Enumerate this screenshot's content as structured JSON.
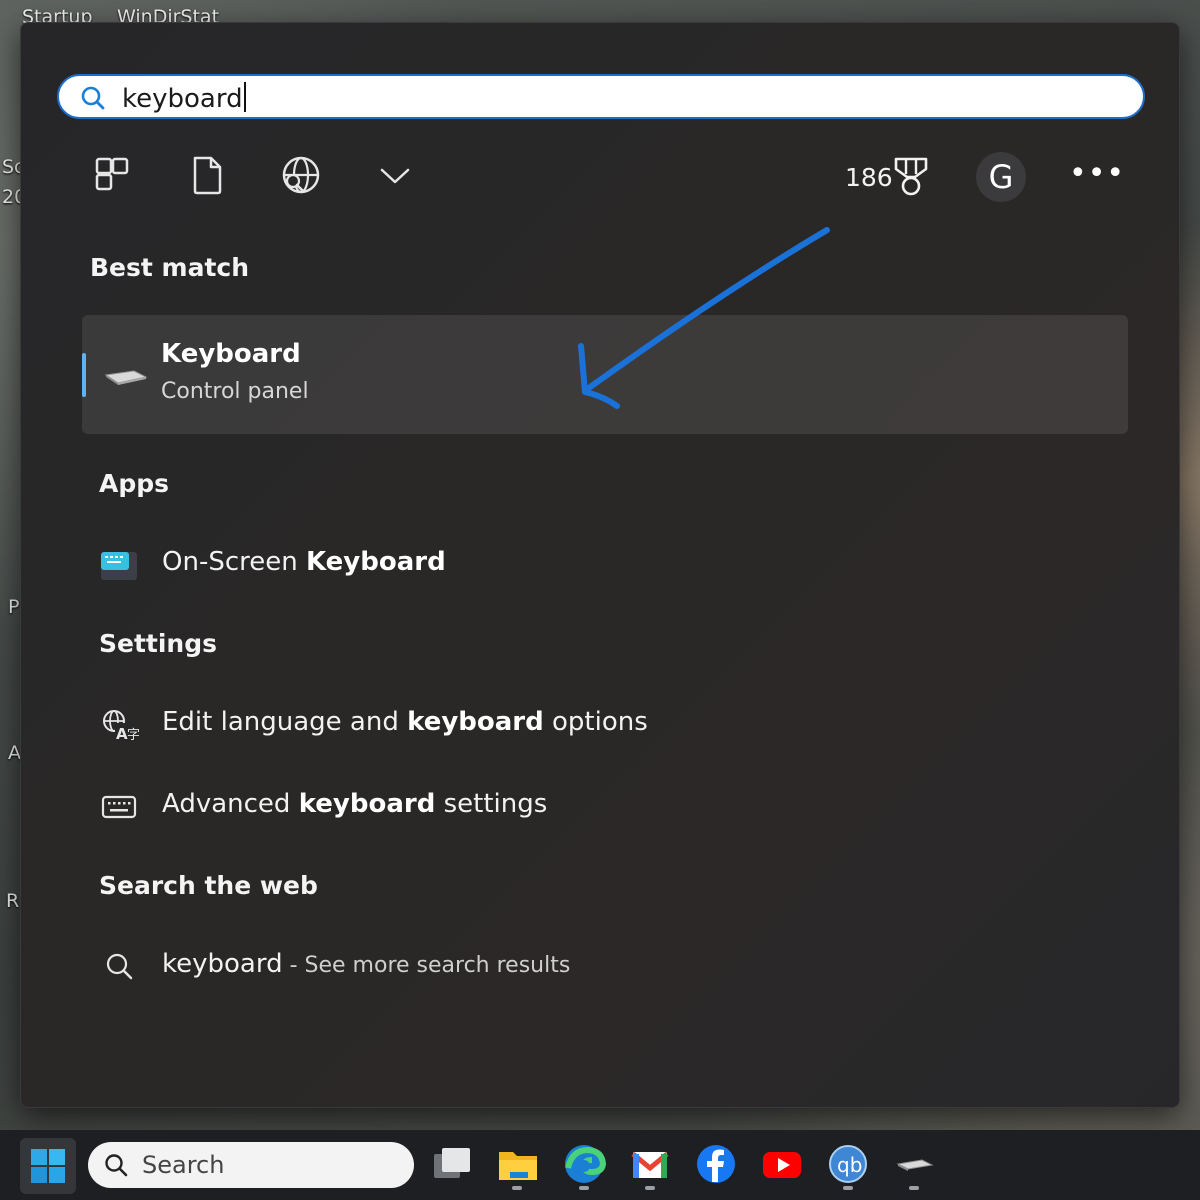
{
  "desktop": {
    "labels": [
      "Startup",
      "WinDirStat",
      "Sc",
      "20",
      "P",
      "A",
      "R"
    ]
  },
  "search": {
    "query": "keyboard"
  },
  "filters": {
    "icons": [
      "apps-filter-icon",
      "documents-filter-icon",
      "web-filter-icon",
      "more-filters-chevron-icon"
    ]
  },
  "header": {
    "points": "186",
    "avatar_letter": "G",
    "more_label": "•••"
  },
  "best_match": {
    "heading": "Best match",
    "title": "Keyboard",
    "subtitle": "Control panel"
  },
  "apps": {
    "heading": "Apps",
    "item_prefix": "On-Screen ",
    "item_bold": "Keyboard"
  },
  "settings": {
    "heading": "Settings",
    "items": [
      {
        "prefix": "Edit language and ",
        "bold": "keyboard",
        "suffix": " options"
      },
      {
        "prefix": "Advanced ",
        "bold": "keyboard",
        "suffix": " settings"
      }
    ]
  },
  "web": {
    "heading": "Search the web",
    "query": "keyboard",
    "hint": " - See more search results"
  },
  "taskbar": {
    "search_label": "Search",
    "apps": [
      "task-view",
      "file-explorer",
      "edge",
      "gmail",
      "facebook",
      "youtube",
      "qbittorrent",
      "keyboard-control-panel"
    ]
  },
  "colors": {
    "accent": "#5fb2f5",
    "annotation_arrow": "#1a72d8",
    "panel_bg": "#272727"
  }
}
